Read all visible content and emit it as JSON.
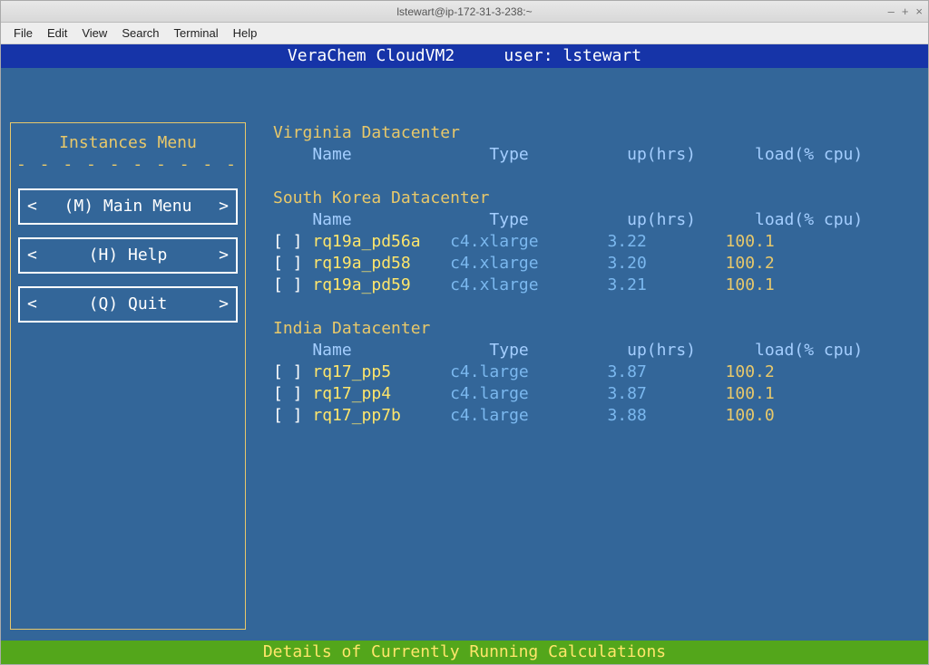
{
  "window": {
    "title": "lstewart@ip-172-31-3-238:~",
    "controls": {
      "min": "–",
      "max": "+",
      "close": "×"
    }
  },
  "menubar": [
    "File",
    "Edit",
    "View",
    "Search",
    "Terminal",
    "Help"
  ],
  "header": {
    "app": "VeraChem CloudVM2",
    "user_label": "user:",
    "user": "lstewart"
  },
  "sidebar": {
    "title": "Instances Menu",
    "dashes": "- - - - - - - - - - - - - -",
    "items": [
      {
        "left": "<",
        "key": "(M)",
        "label": "Main Menu",
        "right": ">"
      },
      {
        "left": "<",
        "key": "(H)",
        "label": "Help",
        "right": ">"
      },
      {
        "left": "<",
        "key": "(Q)",
        "label": "Quit",
        "right": ">"
      }
    ]
  },
  "columns": {
    "name": "Name",
    "type": "Type",
    "up": "up(hrs)",
    "load": "load(% cpu)"
  },
  "datacenters": [
    {
      "title": "Virginia Datacenter",
      "rows": []
    },
    {
      "title": "South Korea Datacenter",
      "rows": [
        {
          "sel": "[ ]",
          "name": "rq19a_pd56a",
          "type": "c4.xlarge",
          "up": "3.22",
          "load": "100.1"
        },
        {
          "sel": "[ ]",
          "name": "rq19a_pd58",
          "type": "c4.xlarge",
          "up": "3.20",
          "load": "100.2"
        },
        {
          "sel": "[ ]",
          "name": "rq19a_pd59",
          "type": "c4.xlarge",
          "up": "3.21",
          "load": "100.1"
        }
      ]
    },
    {
      "title": "India Datacenter",
      "rows": [
        {
          "sel": "[ ]",
          "name": "rq17_pp5",
          "type": "c4.large",
          "up": "3.87",
          "load": "100.2"
        },
        {
          "sel": "[ ]",
          "name": "rq17_pp4",
          "type": "c4.large",
          "up": "3.87",
          "load": "100.1"
        },
        {
          "sel": "[ ]",
          "name": "rq17_pp7b",
          "type": "c4.large",
          "up": "3.88",
          "load": "100.0"
        }
      ]
    }
  ],
  "footer": "Details of Currently Running Calculations"
}
